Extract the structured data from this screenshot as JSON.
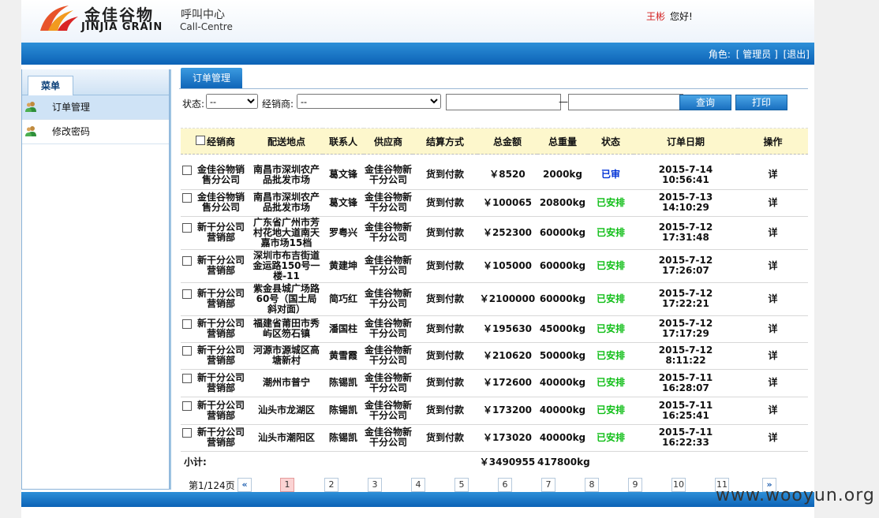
{
  "header": {
    "logo_cn": "金佳谷物",
    "logo_en": "JINJIA GRAIN",
    "logo_sub_cn": "呼叫中心",
    "logo_sub_en": "Call-Centre",
    "user_name": "王彬",
    "greeting": "您好!"
  },
  "topbar": {
    "role_label": "角色:",
    "role_value": "[ 管理员 ]",
    "logout": "[退出]"
  },
  "sidebar": {
    "title": "菜单",
    "items": [
      {
        "label": "订单管理",
        "icon": "users-icon"
      },
      {
        "label": "修改密码",
        "icon": "users-icon"
      }
    ]
  },
  "main": {
    "tab": "订单管理",
    "filter": {
      "status_label": "状态:",
      "status_value": "--",
      "dealer_label": "经销商:",
      "dealer_value": "--",
      "date_sep": "—",
      "query_label": "查询",
      "print_label": "打印"
    },
    "columns": [
      "经销商",
      "配送地点",
      "联系人",
      "供应商",
      "结算方式",
      "总金额",
      "总重量",
      "状态",
      "订单日期",
      "操作"
    ],
    "rows": [
      {
        "dealer": "金佳谷物销售分公司",
        "place": "南昌市深圳农产品批发市场",
        "contact": "葛文锋",
        "supplier": "金佳谷物新干分公司",
        "payment": "货到付款",
        "amount": "￥8520",
        "weight": "2000kg",
        "status": "已审",
        "status_color": "#0032d6",
        "date": "2015-7-14 10:56:41",
        "action": "详"
      },
      {
        "dealer": "金佳谷物销售分公司",
        "place": "南昌市深圳农产品批发市场",
        "contact": "葛文锋",
        "supplier": "金佳谷物新干分公司",
        "payment": "货到付款",
        "amount": "￥100065",
        "weight": "20800kg",
        "status": "已安排",
        "status_color": "#0fbe16",
        "date": "2015-7-13 14:10:29",
        "action": "详"
      },
      {
        "dealer": "新干分公司营销部",
        "place": "广东省广州市芳村花地大道南天嘉市场15档",
        "contact": "罗粤兴",
        "supplier": "金佳谷物新干分公司",
        "payment": "货到付款",
        "amount": "￥252300",
        "weight": "60000kg",
        "status": "已安排",
        "status_color": "#0fbe16",
        "date": "2015-7-12 17:31:48",
        "action": "详"
      },
      {
        "dealer": "新干分公司营销部",
        "place": "深圳市布吉街道金运路150号一楼-11",
        "contact": "黄建坤",
        "supplier": "金佳谷物新干分公司",
        "payment": "货到付款",
        "amount": "￥105000",
        "weight": "60000kg",
        "status": "已安排",
        "status_color": "#0fbe16",
        "date": "2015-7-12 17:26:07",
        "action": "详"
      },
      {
        "dealer": "新干分公司营销部",
        "place": "紫金县城广场路60号（国土局斜对面）",
        "contact": "简巧红",
        "supplier": "金佳谷物新干分公司",
        "payment": "货到付款",
        "amount": "￥2100000",
        "weight": "60000kg",
        "status": "已安排",
        "status_color": "#0fbe16",
        "date": "2015-7-12 17:22:21",
        "action": "详"
      },
      {
        "dealer": "新干分公司营销部",
        "place": "福建省莆田市秀屿区笏石镇",
        "contact": "潘国柱",
        "supplier": "金佳谷物新干分公司",
        "payment": "货到付款",
        "amount": "￥195630",
        "weight": "45000kg",
        "status": "已安排",
        "status_color": "#0fbe16",
        "date": "2015-7-12 17:17:29",
        "action": "详"
      },
      {
        "dealer": "新干分公司营销部",
        "place": "河源市源城区高塘新村",
        "contact": "黄雪霞",
        "supplier": "金佳谷物新干分公司",
        "payment": "货到付款",
        "amount": "￥210620",
        "weight": "50000kg",
        "status": "已安排",
        "status_color": "#0fbe16",
        "date": "2015-7-12 8:11:22",
        "action": "详"
      },
      {
        "dealer": "新干分公司营销部",
        "place": "潮州市普宁",
        "contact": "陈锡凯",
        "supplier": "金佳谷物新干分公司",
        "payment": "货到付款",
        "amount": "￥172600",
        "weight": "40000kg",
        "status": "已安排",
        "status_color": "#0fbe16",
        "date": "2015-7-11 16:28:07",
        "action": "详"
      },
      {
        "dealer": "新干分公司营销部",
        "place": "汕头市龙湖区",
        "contact": "陈锡凯",
        "supplier": "金佳谷物新干分公司",
        "payment": "货到付款",
        "amount": "￥173200",
        "weight": "40000kg",
        "status": "已安排",
        "status_color": "#0fbe16",
        "date": "2015-7-11 16:25:41",
        "action": "详"
      },
      {
        "dealer": "新干分公司营销部",
        "place": "汕头市潮阳区",
        "contact": "陈锡凯",
        "supplier": "金佳谷物新干分公司",
        "payment": "货到付款",
        "amount": "￥173020",
        "weight": "40000kg",
        "status": "已安排",
        "status_color": "#0fbe16",
        "date": "2015-7-11 16:22:33",
        "action": "详"
      }
    ],
    "subtotal": {
      "label": "小计:",
      "amount": "￥3490955",
      "weight": "417800kg"
    },
    "pager": {
      "label": "第1/124页",
      "prev": "«",
      "pages": [
        "1",
        "2",
        "3",
        "4",
        "5",
        "6",
        "7",
        "8",
        "9",
        "10",
        "11"
      ],
      "next": "»",
      "current": "1"
    }
  },
  "watermark": "www.wooyun.org"
}
